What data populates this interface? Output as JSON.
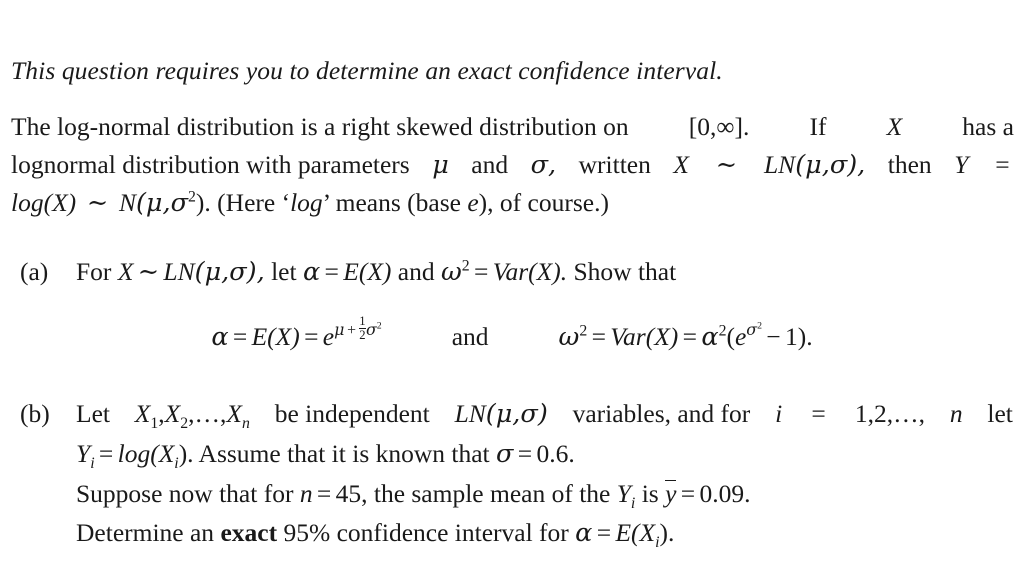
{
  "document": {
    "type": "math-exam-question",
    "topic": "log-normal distribution exact confidence interval",
    "background_color": "#ffffff",
    "text_color": "#1a1a1a"
  },
  "intro_title": "This question requires you to determine an exact confidence interval.",
  "paragraph": {
    "line1_a": "The log-normal distribution is a right skewed distribution on",
    "line1_interval": "[0,∞].",
    "line1_b": "If",
    "line1_X": "X",
    "line1_c": "has a",
    "line2_a": "lognormal distribution with parameters",
    "line2_mu": "μ",
    "line2_and": "and",
    "line2_sigma": "σ,",
    "line2_written": "written",
    "line2_X": "X",
    "line2_sim": "∼",
    "line2_LN": "LN",
    "line2_LN_args": "(μ,σ),",
    "line2_then": "then",
    "line2_Y": "Y",
    "line2_eq": "=",
    "line3_log": "log",
    "line3_logX": "(X)",
    "line3_sim": "∼",
    "line3_N": "N",
    "line3_N_open": "(μ,σ",
    "line3_N_sup": "2",
    "line3_N_close": ").",
    "line3_here": "(Here ‘",
    "line3_log2": "log",
    "line3_here2": "’ means (base",
    "line3_e": "e",
    "line3_here3": "), of course.)"
  },
  "part_a": {
    "marker": "(a)",
    "text_for": "For",
    "X": "X",
    "sim": "∼",
    "LN": "LN",
    "LN_args": "(μ,σ),",
    "let": "let",
    "alpha": "α",
    "eq": "=",
    "E": "E",
    "EX": "(X)",
    "and": "and",
    "omega": "ω",
    "omega_sup": "2",
    "eq2": "=",
    "Var": "Var",
    "VarX": "(X).",
    "show": "Show that"
  },
  "display_equation": {
    "alpha": "α",
    "eq1": "=",
    "E": "E",
    "EX": "(X)",
    "eq2": "=",
    "e": "e",
    "exp_mu": "μ",
    "exp_plus": "+",
    "frac_num": "1",
    "frac_den": "2",
    "exp_sigma": "σ",
    "exp_sigma_sup": "2",
    "and": "and",
    "omega": "ω",
    "omega_sup": "2",
    "eq3": "=",
    "Var": "Var",
    "VarX": "(X)",
    "eq4": "=",
    "alpha2": "α",
    "alpha2_sup": "2",
    "open": "(",
    "e2": "e",
    "e2_sigma": "σ",
    "e2_sigma_sup": "2",
    "minus": "−",
    "one": "1",
    "close": ")."
  },
  "part_b": {
    "marker": "(b)",
    "let": "Let",
    "X1": "X",
    "X1_sub": "1",
    "comma1": ",",
    "X2": "X",
    "X2_sub": "2",
    "dots": ",…,",
    "Xn": "X",
    "Xn_sub": "n",
    "be_indep": "be independent",
    "LN": "LN",
    "LN_args": "(μ,σ)",
    "variables": "variables, and for",
    "i": "i",
    "eq": "=",
    "i_values": "1,2,…,",
    "n": "n",
    "let2": "let",
    "line2_Y": "Y",
    "line2_Y_sub": "i",
    "line2_eq": "=",
    "line2_log": "log",
    "line2_logX": "(X",
    "line2_logX_sub": "i",
    "line2_logX_close": ").",
    "line2_assume": "Assume that it is known that",
    "line2_sigma": "σ",
    "line2_eq2": "=",
    "line2_sigma_val": "0.6.",
    "line3_suppose": "Suppose now that for",
    "line3_n": "n",
    "line3_eq": "=",
    "line3_n_val": "45,",
    "line3_sample": "the sample mean of the",
    "line3_Y": "Y",
    "line3_Y_sub": "i",
    "line3_is": "is",
    "line3_ybar": "y",
    "line3_eq2": "=",
    "line3_ybar_val": "0.09.",
    "line4_determine": "Determine an",
    "line4_exact": "exact",
    "line4_pct": "95%",
    "line4_ci": "confidence interval for",
    "line4_alpha": "α",
    "line4_eq": "=",
    "line4_E": "E",
    "line4_EX": "(X",
    "line4_EX_sub": "i",
    "line4_EX_close": ")."
  }
}
